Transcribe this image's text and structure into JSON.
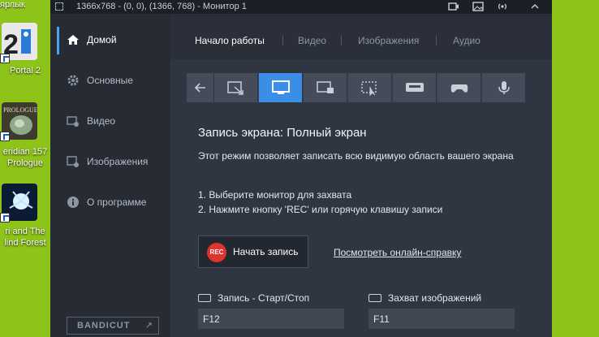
{
  "desktop": {
    "top_label": "ярлык",
    "icons": [
      {
        "label_line1": "Portal 2",
        "label_line2": ""
      },
      {
        "label_line1": "eridian 157",
        "label_line2": "Prologue"
      },
      {
        "label_line1": "ri and The",
        "label_line2": "lind Forest"
      }
    ]
  },
  "window": {
    "title": "1366x768 - (0, 0), (1366, 768) - Монитор 1",
    "title_icons": [
      "video-icon",
      "image-icon",
      "broadcast-icon",
      "chevron-up-icon"
    ]
  },
  "sidebar": {
    "items": [
      {
        "label": "Домой",
        "icon": "home-icon",
        "active": true
      },
      {
        "label": "Основные",
        "icon": "gear-icon",
        "active": false
      },
      {
        "label": "Видео",
        "icon": "video-settings-icon",
        "active": false
      },
      {
        "label": "Изображения",
        "icon": "image-settings-icon",
        "active": false
      },
      {
        "label": "О программе",
        "icon": "info-icon",
        "active": false
      }
    ],
    "bandicut_label": "BANDICUT",
    "bandicut_arrow": "↗"
  },
  "tabs": [
    {
      "label": "Начало работы",
      "active": true
    },
    {
      "label": "Видео",
      "active": false
    },
    {
      "label": "Изображения",
      "active": false
    },
    {
      "label": "Аудио",
      "active": false
    }
  ],
  "toolbar": {
    "modes": [
      "back-arrow-icon",
      "rectangle-area-icon",
      "fullscreen-monitor-icon",
      "window-lock-icon",
      "mouse-area-icon",
      "hdmi-device-icon",
      "gamepad-icon",
      "microphone-icon"
    ],
    "active_index": 2
  },
  "content": {
    "heading": "Запись экрана: Полный экран",
    "description": "Этот режим позволяет записать всю видимую область вашего экрана",
    "steps": [
      "1. Выберите монитор для захвата",
      "2. Нажмите кнопку 'REC' или горячую клавишу записи"
    ],
    "rec_badge": "REC",
    "rec_button_label": "Начать запись",
    "help_link": "Посмотреть онлайн-справку"
  },
  "hotkeys": [
    {
      "label": "Запись - Старт/Стоп",
      "value": "F12"
    },
    {
      "label": "Захват изображений",
      "value": "F11"
    }
  ],
  "colors": {
    "accent": "#3a8ee6",
    "rec_red": "#e0322e",
    "desktop_green": "#8ec31a"
  }
}
